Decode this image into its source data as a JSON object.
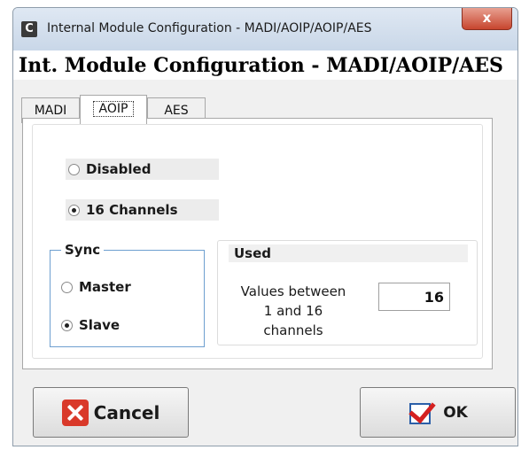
{
  "window": {
    "title": "Internal Module Configuration - MADI/AOIP/AOIP/AES",
    "app_icon": "C",
    "close_glyph": "x"
  },
  "header": {
    "title": "Int. Module Configuration - MADI/AOIP/AES"
  },
  "tabs": [
    {
      "label": "MADI",
      "active": false
    },
    {
      "label": "AOIP",
      "active": true
    },
    {
      "label": "AES",
      "active": false
    }
  ],
  "mode": {
    "options": [
      {
        "label": "Disabled",
        "selected": false
      },
      {
        "label": "16 Channels",
        "selected": true
      }
    ]
  },
  "sync": {
    "label": "Sync",
    "options": [
      {
        "label": "Master",
        "selected": false
      },
      {
        "label": "Slave",
        "selected": true
      }
    ]
  },
  "used": {
    "label": "Used",
    "note_line1": "Values between",
    "note_line2": "1 and 16",
    "note_line3": "channels",
    "value": "16"
  },
  "buttons": {
    "cancel": "Cancel",
    "ok": "OK"
  },
  "colors": {
    "cancel_icon": "#d9392a",
    "ok_check": "#d42020",
    "ok_box": "#2b5fa8",
    "sync_border": "#6e9fd0"
  }
}
